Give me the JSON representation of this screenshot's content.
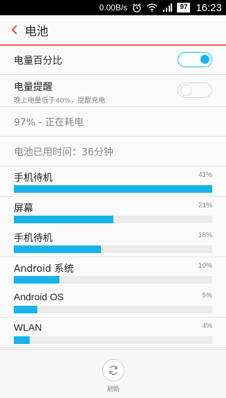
{
  "status_bar": {
    "speed": "0.00B/s",
    "battery": "97",
    "time": "16:23"
  },
  "header": {
    "title": "电池"
  },
  "settings": {
    "battery_percent": {
      "label": "电量百分比",
      "enabled": true
    },
    "battery_reminder": {
      "label": "电量提醒",
      "subtitle": "晚上电量低于40%，提醒充电",
      "enabled": false
    }
  },
  "status_text": "97% - 正在耗电",
  "usage_time": "电池已用时间：36分钟",
  "usage": [
    {
      "name": "手机待机",
      "percent_text": "41%",
      "fraction": 1.0
    },
    {
      "name": "屏幕",
      "percent_text": "21%",
      "fraction": 0.5
    },
    {
      "name": "手机待机",
      "percent_text": "18%",
      "fraction": 0.44
    },
    {
      "name": "Android 系统",
      "percent_text": "10%",
      "fraction": 0.23
    },
    {
      "name": "Android OS",
      "percent_text": "5%",
      "fraction": 0.12
    },
    {
      "name": "WLAN",
      "percent_text": "4%",
      "fraction": 0.08
    }
  ],
  "bottom": {
    "refresh_label": "刷新"
  },
  "colors": {
    "accent": "#16b4ea",
    "header_line": "#ff5a4a",
    "back": "#e8473a"
  }
}
